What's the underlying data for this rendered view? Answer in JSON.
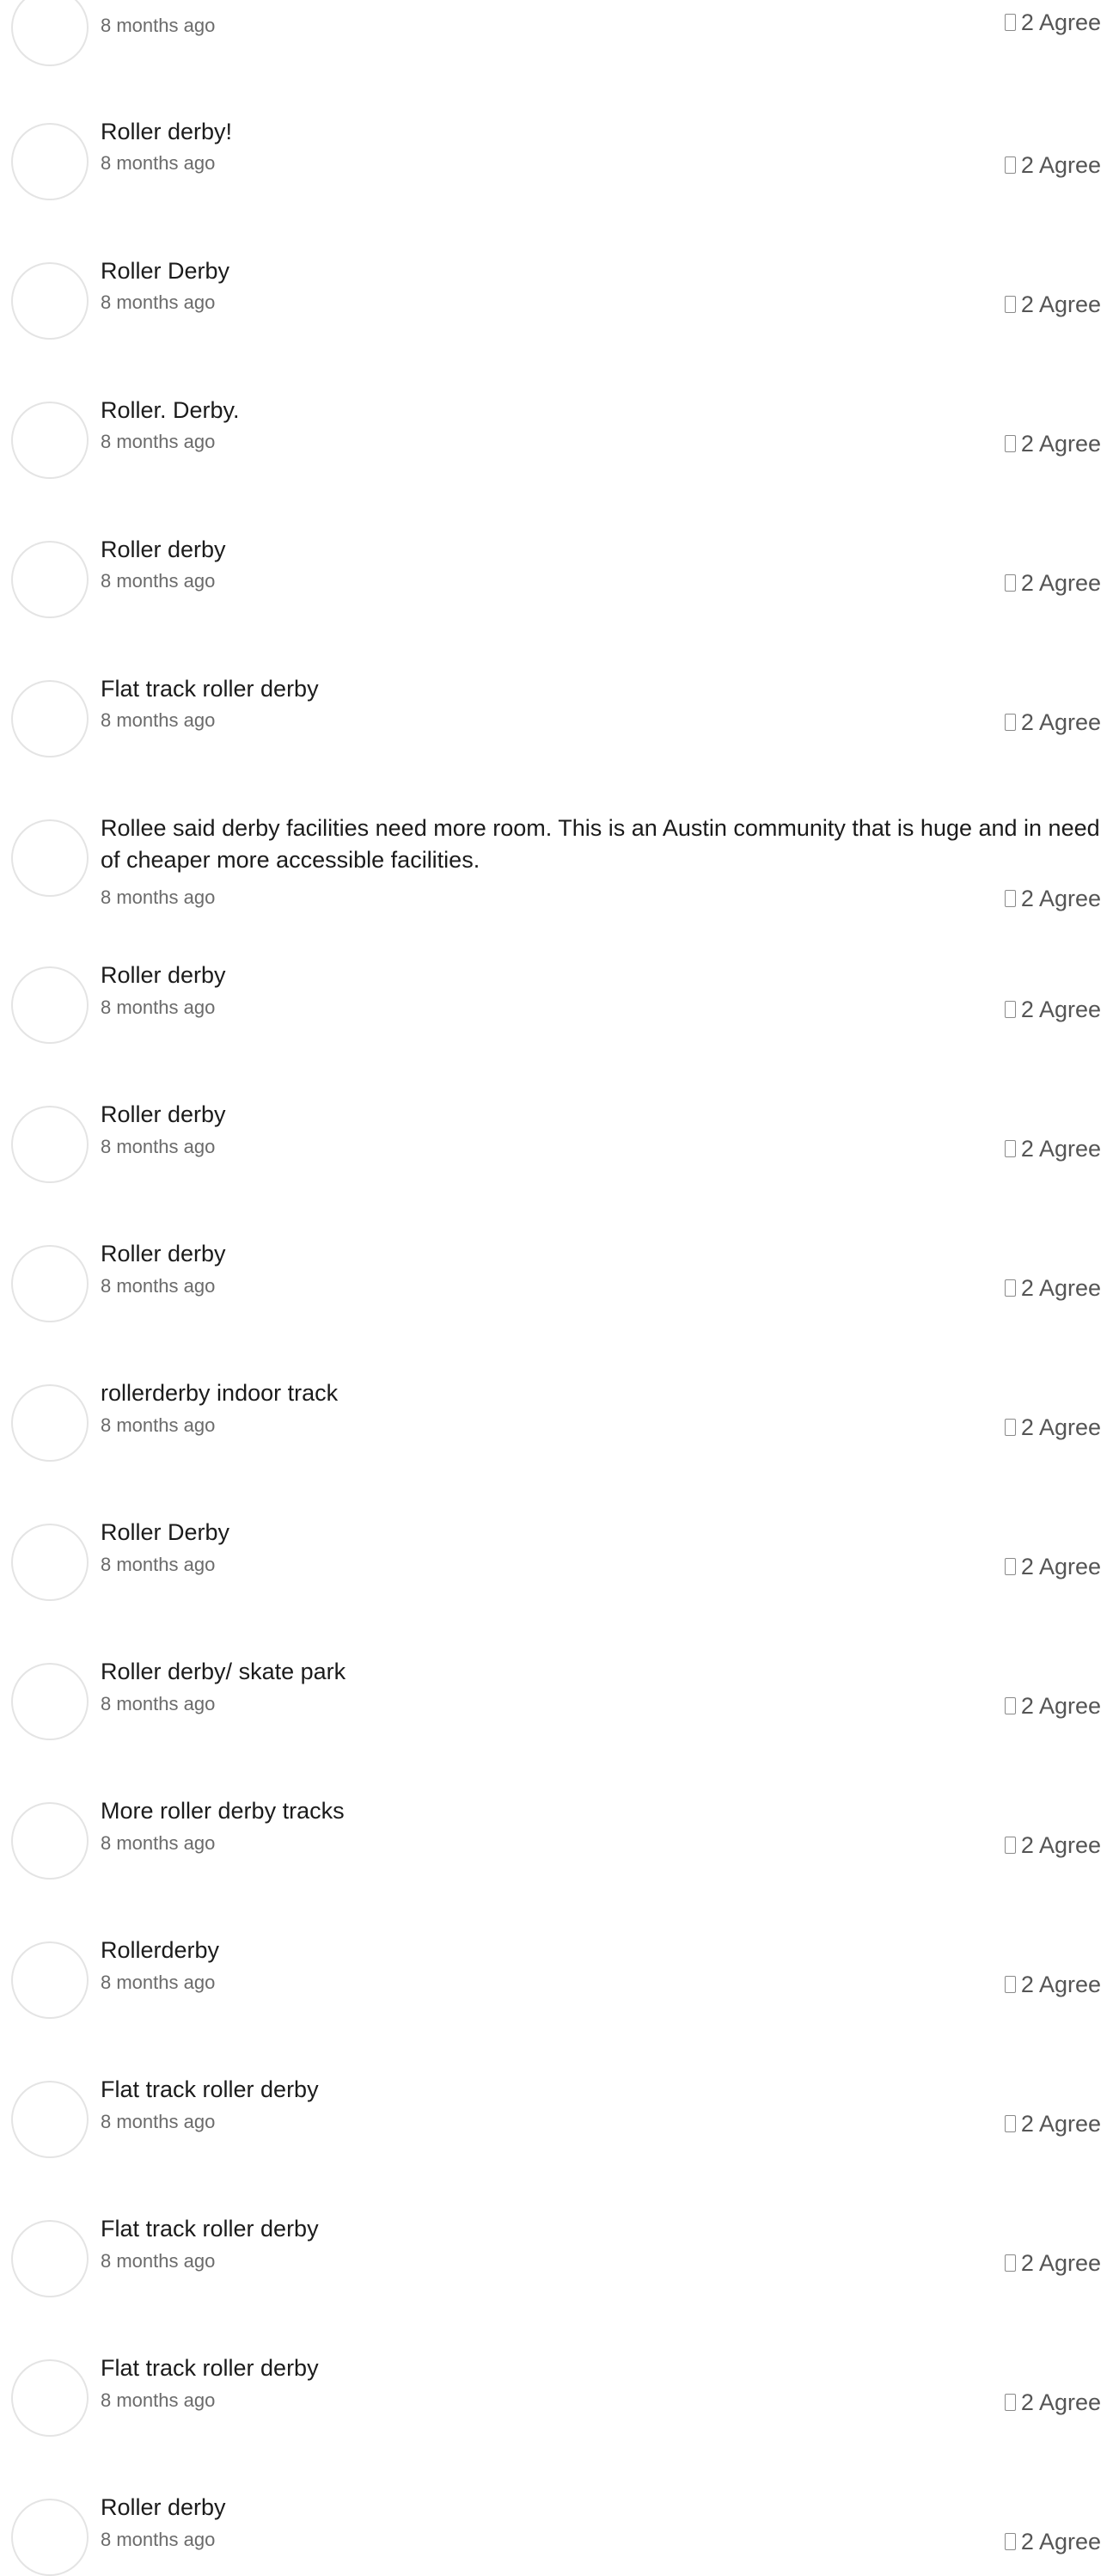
{
  "comments": [
    {
      "text": "",
      "time": "8 months ago",
      "agree_count": "2",
      "agree_label": "Agree"
    },
    {
      "text": "Roller derby!",
      "time": "8 months ago",
      "agree_count": "2",
      "agree_label": "Agree"
    },
    {
      "text": "Roller Derby",
      "time": "8 months ago",
      "agree_count": "2",
      "agree_label": "Agree"
    },
    {
      "text": "Roller. Derby.",
      "time": "8 months ago",
      "agree_count": "2",
      "agree_label": "Agree"
    },
    {
      "text": "Roller derby",
      "time": "8 months ago",
      "agree_count": "2",
      "agree_label": "Agree"
    },
    {
      "text": "Flat track roller derby",
      "time": "8 months ago",
      "agree_count": "2",
      "agree_label": "Agree"
    },
    {
      "text": "Rollee said derby facilities need more room. This is an Austin community that is huge and in need of cheaper more accessible facilities.",
      "time": "8 months ago",
      "agree_count": "2",
      "agree_label": "Agree"
    },
    {
      "text": "Roller derby",
      "time": "8 months ago",
      "agree_count": "2",
      "agree_label": "Agree"
    },
    {
      "text": "Roller derby",
      "time": "8 months ago",
      "agree_count": "2",
      "agree_label": "Agree"
    },
    {
      "text": "Roller derby",
      "time": "8 months ago",
      "agree_count": "2",
      "agree_label": "Agree"
    },
    {
      "text": "rollerderby indoor track",
      "time": "8 months ago",
      "agree_count": "2",
      "agree_label": "Agree"
    },
    {
      "text": "Roller Derby",
      "time": "8 months ago",
      "agree_count": "2",
      "agree_label": "Agree"
    },
    {
      "text": "Roller derby/ skate park",
      "time": "8 months ago",
      "agree_count": "2",
      "agree_label": "Agree"
    },
    {
      "text": "More roller derby tracks",
      "time": "8 months ago",
      "agree_count": "2",
      "agree_label": "Agree"
    },
    {
      "text": "Rollerderby",
      "time": "8 months ago",
      "agree_count": "2",
      "agree_label": "Agree"
    },
    {
      "text": "Flat track roller derby",
      "time": "8 months ago",
      "agree_count": "2",
      "agree_label": "Agree"
    },
    {
      "text": "Flat track roller derby",
      "time": "8 months ago",
      "agree_count": "2",
      "agree_label": "Agree"
    },
    {
      "text": "Flat track roller derby",
      "time": "8 months ago",
      "agree_count": "2",
      "agree_label": "Agree"
    },
    {
      "text": "Roller derby",
      "time": "8 months ago",
      "agree_count": "2",
      "agree_label": "Agree"
    }
  ]
}
